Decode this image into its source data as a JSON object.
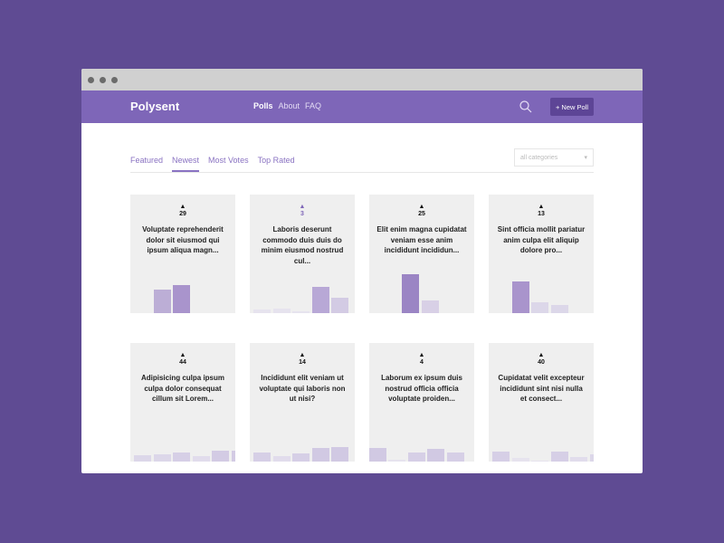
{
  "app": {
    "brand": "Polysent",
    "nav": [
      "Polls",
      "About",
      "FAQ"
    ],
    "new_poll": "+ New Poll"
  },
  "tabs": [
    "Featured",
    "Newest",
    "Most Votes",
    "Top Rated"
  ],
  "active_tab": 1,
  "category_select": {
    "value": "all categories"
  },
  "polls": [
    {
      "votes": "29",
      "voted": false,
      "question": "Voluptate reprehenderit dolor sit eiusmod qui ipsum aliqua magn...",
      "bars": [
        0,
        26,
        31
      ],
      "colors": [
        "#bcaed6",
        "#bcaed6",
        "#a994cc"
      ]
    },
    {
      "votes": "3",
      "voted": true,
      "question": "Laboris deserunt commodo duis duis do minim eiusmod nostrud cul...",
      "bars": [
        4,
        5,
        2,
        29,
        17
      ],
      "colors": [
        "#e6e3ee",
        "#e6e3ee",
        "#e6e3ee",
        "#b8a8d6",
        "#d3cbe4"
      ]
    },
    {
      "votes": "25",
      "voted": false,
      "question": "Elit enim magna cupidatat veniam esse anim incididunt incididun...",
      "bars": [
        0,
        43,
        14
      ],
      "colors": [
        "#fff",
        "#9b85c4",
        "#d8d0e6"
      ],
      "shift": 0.5
    },
    {
      "votes": "13",
      "voted": false,
      "question": "Sint officia mollit pariatur anim culpa elit aliquip dolore pro...",
      "bars": [
        0,
        35,
        12,
        9
      ],
      "colors": [
        "#fff",
        "#a994cc",
        "#dcd7e9",
        "#dcd7e9"
      ]
    },
    {
      "votes": "44",
      "voted": false,
      "question": "Adipisicing culpa ipsum culpa dolor consequat cillum sit Lorem...",
      "bars": [
        7,
        8,
        10,
        6,
        12,
        12
      ],
      "colors": [
        "#dcd7e9",
        "#dcd7e9",
        "#d6cfe6",
        "#e1dcec",
        "#d3cbe4",
        "#d3cbe4"
      ]
    },
    {
      "votes": "14",
      "voted": false,
      "question": "Incididunt elit veniam ut voluptate qui laboris non ut nisi?",
      "bars": [
        10,
        6,
        9,
        15,
        16
      ],
      "colors": [
        "#d6cfe6",
        "#e1dcec",
        "#d6cfe6",
        "#d1c9e3",
        "#d1c9e3"
      ]
    },
    {
      "votes": "4",
      "voted": false,
      "question": "Laborum ex ipsum duis nostrud officia officia voluptate proiden...",
      "bars": [
        15,
        2,
        10,
        14,
        10
      ],
      "colors": [
        "#d1c9e3",
        "#e6e3ee",
        "#d6cfe6",
        "#d1c9e3",
        "#d6cfe6"
      ],
      "shift": -0.2
    },
    {
      "votes": "40",
      "voted": false,
      "question": "Cupidatat velit excepteur incididunt sint nisi nulla et consect...",
      "bars": [
        11,
        4,
        1,
        11,
        5,
        8
      ],
      "colors": [
        "#d6cfe6",
        "#e6e3ee",
        "#e6e3ee",
        "#d6cfe6",
        "#e1dcec",
        "#dcd7e9"
      ]
    }
  ]
}
